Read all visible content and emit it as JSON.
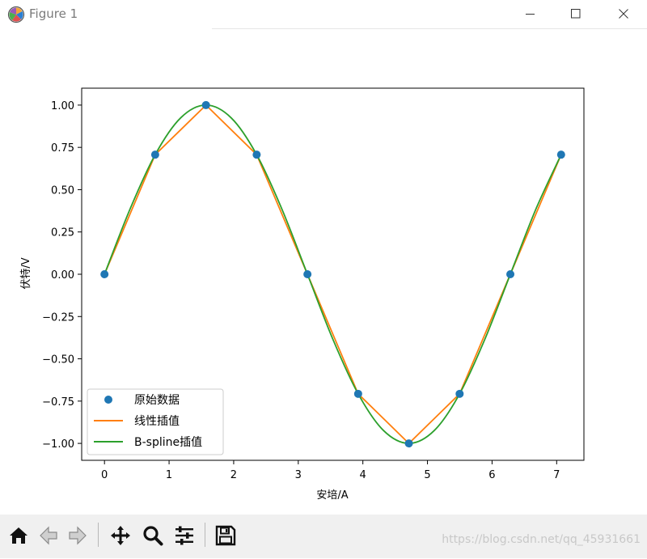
{
  "window": {
    "title": "Figure 1",
    "controls": {
      "minimize": "minimize-icon",
      "maximize": "maximize-icon",
      "close": "close-icon"
    }
  },
  "toolbar": {
    "buttons": [
      {
        "name": "home-button",
        "icon": "home-icon"
      },
      {
        "name": "back-button",
        "icon": "arrow-left-icon"
      },
      {
        "name": "forward-button",
        "icon": "arrow-right-icon"
      },
      {
        "name": "pan-button",
        "icon": "move-icon"
      },
      {
        "name": "zoom-button",
        "icon": "magnifier-icon"
      },
      {
        "name": "configure-subplots-button",
        "icon": "sliders-icon"
      },
      {
        "name": "save-button",
        "icon": "floppy-icon"
      }
    ]
  },
  "watermark": "https://blog.csdn.net/qq_45931661",
  "chart_data": {
    "type": "line",
    "title": "",
    "xlabel": "安培/A",
    "ylabel": "伏特/V",
    "xlim": [
      -0.353,
      7.422
    ],
    "ylim": [
      -1.1,
      1.1
    ],
    "xticks": [
      0,
      1,
      2,
      3,
      4,
      5,
      6,
      7
    ],
    "xtick_labels": [
      "0",
      "1",
      "2",
      "3",
      "4",
      "5",
      "6",
      "7"
    ],
    "yticks": [
      1.0,
      0.75,
      0.5,
      0.25,
      0.0,
      -0.25,
      -0.5,
      -0.75,
      -1.0
    ],
    "ytick_labels": [
      "1.00",
      "0.75",
      "0.50",
      "0.25",
      "0.00",
      "−0.25",
      "−0.50",
      "−0.75",
      "−1.00"
    ],
    "grid": false,
    "legend_position": "lower-left",
    "series": [
      {
        "name": "原始数据",
        "type": "scatter",
        "color": "#1f77b4",
        "x": [
          0,
          0.785,
          1.571,
          2.356,
          3.142,
          3.927,
          4.712,
          5.498,
          6.283,
          7.069
        ],
        "y": [
          0,
          0.707,
          1.0,
          0.707,
          0,
          -0.707,
          -1.0,
          -0.707,
          0,
          0.707
        ]
      },
      {
        "name": "线性插值",
        "type": "line",
        "color": "#ff7f0e",
        "x": [
          0,
          0.785,
          1.571,
          2.356,
          3.142,
          3.927,
          4.712,
          5.498,
          6.283,
          7.069
        ],
        "y": [
          0,
          0.707,
          1.0,
          0.707,
          0,
          -0.707,
          -1.0,
          -0.707,
          0,
          0.707
        ]
      },
      {
        "name": "B-spline插值",
        "type": "line",
        "color": "#2ca02c",
        "x": [
          0,
          0.393,
          0.785,
          1.178,
          1.571,
          1.963,
          2.356,
          2.749,
          3.142,
          3.534,
          3.927,
          4.32,
          4.712,
          5.105,
          5.498,
          5.89,
          6.283,
          6.676,
          7.069
        ],
        "y": [
          0,
          0.383,
          0.707,
          0.924,
          1.0,
          0.924,
          0.707,
          0.383,
          0,
          -0.383,
          -0.707,
          -0.924,
          -1.0,
          -0.924,
          -0.707,
          -0.383,
          0,
          0.383,
          0.707
        ]
      }
    ]
  }
}
